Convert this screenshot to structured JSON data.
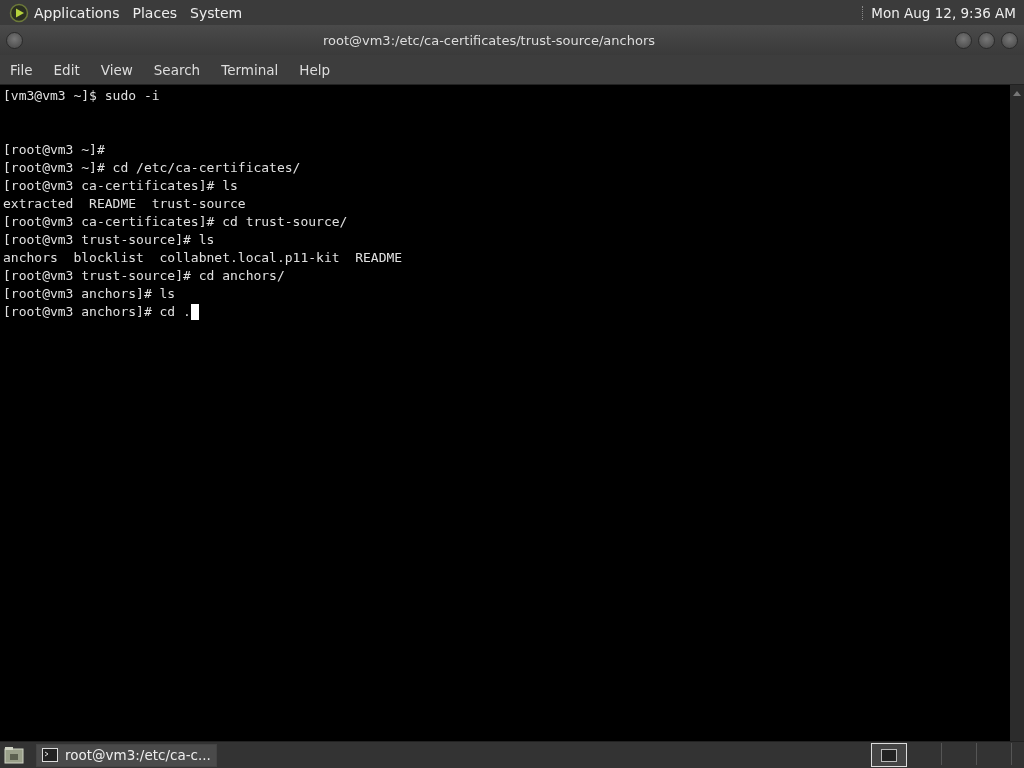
{
  "top_panel": {
    "menus": [
      "Applications",
      "Places",
      "System"
    ],
    "clock": "Mon Aug 12,  9:36 AM"
  },
  "window": {
    "title": "root@vm3:/etc/ca-certificates/trust-source/anchors"
  },
  "menu_bar": [
    "File",
    "Edit",
    "View",
    "Search",
    "Terminal",
    "Help"
  ],
  "terminal": {
    "blocks": [
      [
        "[vm3@vm3 ~]$ sudo -i"
      ],
      [
        "[root@vm3 ~]#",
        "[root@vm3 ~]# cd /etc/ca-certificates/",
        "[root@vm3 ca-certificates]# ls",
        "extracted  README  trust-source",
        "[root@vm3 ca-certificates]# cd trust-source/",
        "[root@vm3 trust-source]# ls",
        "anchors  blocklist  collabnet.local.p11-kit  README",
        "[root@vm3 trust-source]# cd anchors/",
        "[root@vm3 anchors]# ls",
        "[root@vm3 anchors]# cd ."
      ]
    ],
    "cursor": true
  },
  "taskbar": {
    "windows": [
      {
        "label": "root@vm3:/etc/ca-c...",
        "selected": true
      }
    ],
    "workspaces": [
      {
        "selected": true
      },
      {
        "selected": false
      },
      {
        "selected": false
      },
      {
        "selected": false
      }
    ]
  }
}
